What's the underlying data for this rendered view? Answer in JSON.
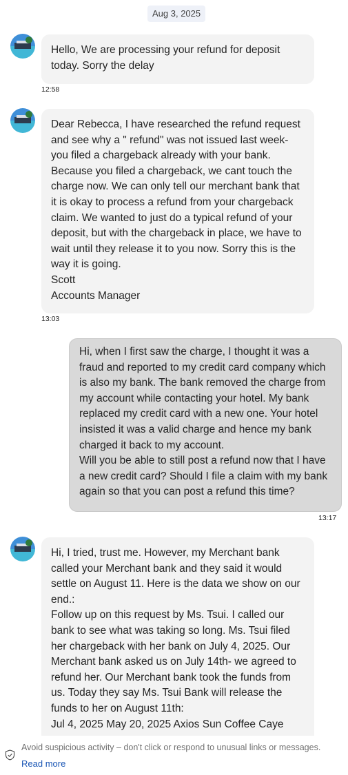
{
  "date_separator": "Aug 3, 2025",
  "messages": [
    {
      "text": "Hello, We are processing your refund for deposit\ntoday. Sorry the delay",
      "time": "12:58"
    },
    {
      "text": "Dear Rebecca, I have researched the refund request\nand see why a \" refund\" was not issued last week-\nyou filed a chargeback already with your bank.\nBecause you filed a chargeback, we cant touch the\ncharge now. We can only tell our merchant bank that\nit is okay to process a refund from your chargeback\nclaim. We wanted to just do a typical refund of your\ndeposit, but with the chargeback in place, we have to\nwait until they release it to you now. Sorry this is the\nway it is going.\nScott\nAccounts Manager",
      "time": "13:03"
    },
    {
      "text": "Hi, when I first saw the charge, I thought it was a\nfraud and reported to my credit card company which\nis also my bank. The bank removed the charge from\nmy account while contacting your hotel. My bank\nreplaced my credit card with a new one. Your hotel\ninsisted it was a valid charge and hence my bank\ncharged it back to my account.\nWill you be able to still post a refund now that I have\na new credit card? Should I file a claim with my bank\nagain so that you can post a refund this time?",
      "time": "13:17"
    },
    {
      "text": "Hi, I tried, trust me. However, my Merchant bank\ncalled your Merchant bank and they said it would\nsettle on August 11. Here is the data we show on our\nend.:\nFollow up on this request by Ms. Tsui. I called our\nbank to see what was taking so long. Ms. Tsui filed\nher chargeback with her bank on July 4, 2025. Our\nMerchant bank asked us on July 14th- we agreed to\nrefund her. Our Merchant bank took the funds from\nus. Today they say Ms. Tsui Bank will release the\nfunds to her on August 11th:\nJul 4, 2025 May 20, 2025 Axios Sun Coffee Caye"
    }
  ],
  "footer": {
    "warning": "Avoid suspicious activity – don't click or respond to unusual links or messages.",
    "read_more": "Read more",
    "icon": "shield-check-icon"
  }
}
